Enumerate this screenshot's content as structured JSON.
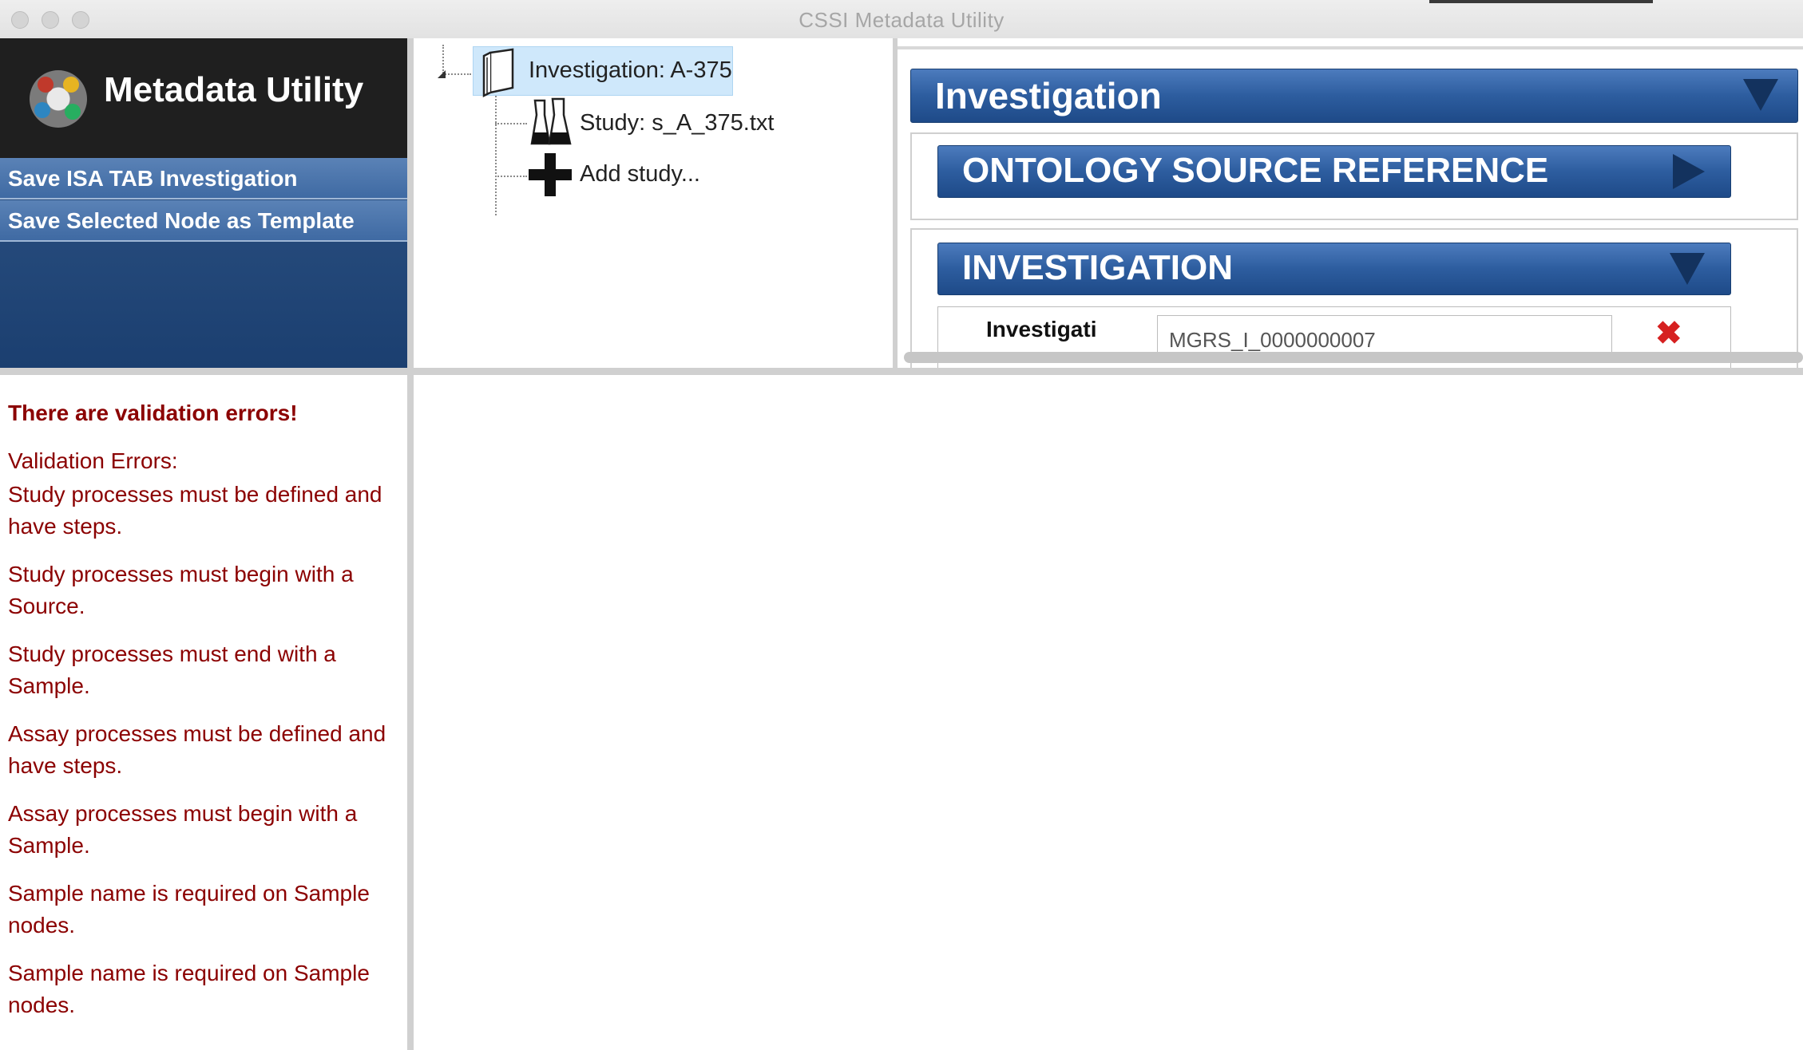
{
  "window": {
    "title": "CSSI Metadata Utility"
  },
  "sidebar": {
    "app_name": "Metadata Utility",
    "menu": [
      {
        "label": "Save ISA TAB Investigation"
      },
      {
        "label": "Save Selected Node as Template"
      }
    ]
  },
  "tree": {
    "nodes": [
      {
        "label": "Investigation: A-375",
        "icon": "book-icon",
        "selected": true
      },
      {
        "label": "Study: s_A_375.txt",
        "icon": "flask-icon"
      },
      {
        "label": "Add study...",
        "icon": "plus-icon"
      }
    ]
  },
  "details": {
    "header": "Investigation",
    "sections": [
      {
        "title": "ONTOLOGY SOURCE REFERENCE",
        "state": "collapsed"
      },
      {
        "title": "INVESTIGATION",
        "state": "expanded"
      }
    ],
    "fields": [
      {
        "label": "Investigati",
        "value": "MGRS_I_0000000007"
      }
    ]
  },
  "validation": {
    "heading": "There are validation errors!",
    "subheading": "Validation Errors:",
    "errors": [
      "Study processes must be defined and have steps.",
      "Study processes must begin with a Source.",
      "Study processes must end with a Sample.",
      "Assay processes must be defined and have steps.",
      "Assay processes must begin with a Sample.",
      "Sample name is required on Sample nodes.",
      "Sample name is required on Sample nodes."
    ]
  },
  "colors": {
    "error_text": "#8b0000",
    "accent_blue": "#2d5d9f",
    "selection": "#cfe8fb"
  }
}
